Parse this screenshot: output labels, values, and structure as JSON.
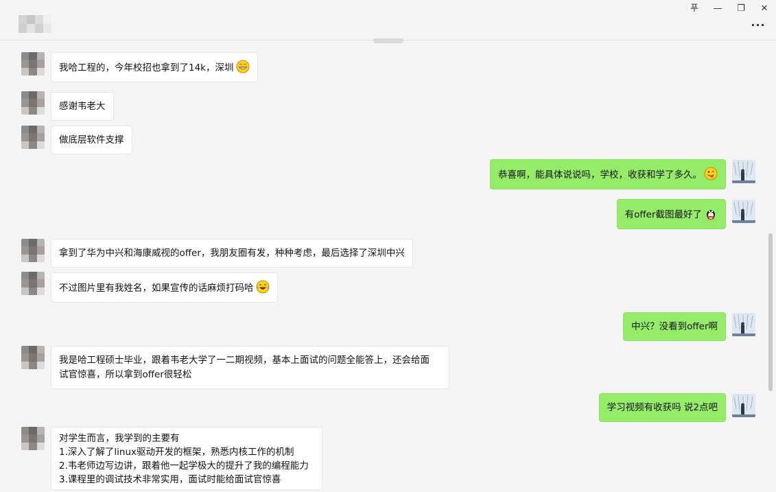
{
  "window": {
    "controls": {
      "pin": "푸",
      "minimize": "—",
      "restore": "❐",
      "close": "✕"
    },
    "more_label": "···"
  },
  "colors": {
    "background": "#f5f5f5",
    "bubble_sent": "#95ec69",
    "bubble_received": "#ffffff"
  },
  "messages": [
    {
      "side": "left",
      "lines": [
        "我哈工程的，今年校招也拿到了14k，深圳"
      ],
      "emoji": "grin-icon"
    },
    {
      "side": "left",
      "lines": [
        "感谢韦老大"
      ]
    },
    {
      "side": "left",
      "lines": [
        "做底层软件支撑"
      ]
    },
    {
      "side": "right",
      "lines": [
        "恭喜啊，能具体说说吗，学校，收获和学了多久。"
      ],
      "emoji": "wink-tongue-icon"
    },
    {
      "side": "right",
      "lines": [
        "有offer截图最好了"
      ],
      "emoji": "penguin-icon"
    },
    {
      "side": "left",
      "lines": [
        "拿到了华为中兴和海康威视的offer，我朋友圈有发，种种考虑，最后选择了深圳中兴"
      ]
    },
    {
      "side": "left",
      "lines": [
        "不过图片里有我姓名，如果宣传的话麻烦打码哈"
      ],
      "emoji": "laugh-tears-icon"
    },
    {
      "side": "right",
      "lines": [
        "中兴？没看到offer啊"
      ]
    },
    {
      "side": "left",
      "lines": [
        "我是哈工程硕士毕业，跟着韦老大学了一二期视频，基本上面试的问题全能答上，还会给面",
        "试官惊喜，所以拿到offer很轻松"
      ]
    },
    {
      "side": "right",
      "lines": [
        "学习视频有收获吗 说2点吧"
      ]
    },
    {
      "side": "left",
      "lines": [
        "对学生而言，我学到的主要有",
        "1.深入了解了linux驱动开发的框架，熟悉内核工作的机制",
        "2.韦老师边写边讲，跟着他一起学极大的提升了我的编程能力",
        "3.课程里的调试技术非常实用，面试时能给面试官惊喜"
      ]
    }
  ]
}
